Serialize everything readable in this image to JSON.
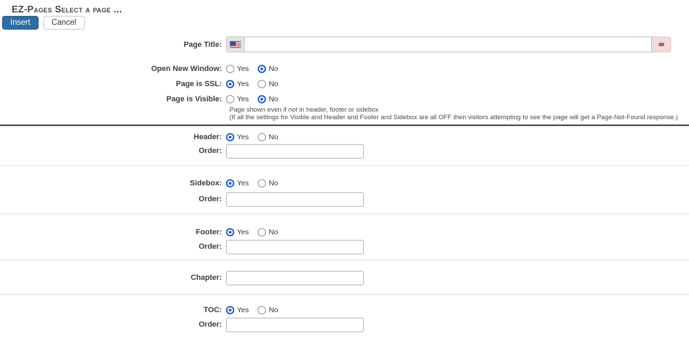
{
  "header": {
    "title": "EZ-Pages Select a page ...",
    "insert_label": "Insert",
    "cancel_label": "Cancel"
  },
  "common": {
    "yes": "Yes",
    "no": "No",
    "order_label": "Order:"
  },
  "fields": {
    "page_title": {
      "label": "Page Title:",
      "value": "",
      "flag_icon": "us-flag-icon"
    },
    "open_new_window": {
      "label": "Open New Window:",
      "selected": "no"
    },
    "page_is_ssl": {
      "label": "Page is SSL:",
      "selected": "yes"
    },
    "page_is_visible": {
      "label": "Page is Visible:",
      "selected": "no",
      "help_line1": "Page shown even if not in header, footer or sidebox",
      "help_line2": "(If all the settings for Visible and Header and Footer and Sidebox are all OFF then visitors attempting to see the page will get a Page-Not-Found response.)"
    },
    "header_section": {
      "label": "Header:",
      "selected": "yes",
      "order_value": ""
    },
    "sidebox": {
      "label": "Sidebox:",
      "selected": "yes",
      "order_value": ""
    },
    "footer": {
      "label": "Footer:",
      "selected": "yes",
      "order_value": ""
    },
    "chapter": {
      "label": "Chapter:",
      "value": ""
    },
    "toc": {
      "label": "TOC:",
      "selected": "yes",
      "order_value": ""
    }
  },
  "colors": {
    "primary_button": "#2d6da3",
    "radio_selected": "#1c62d6",
    "required_accent": "#c25b5b"
  }
}
